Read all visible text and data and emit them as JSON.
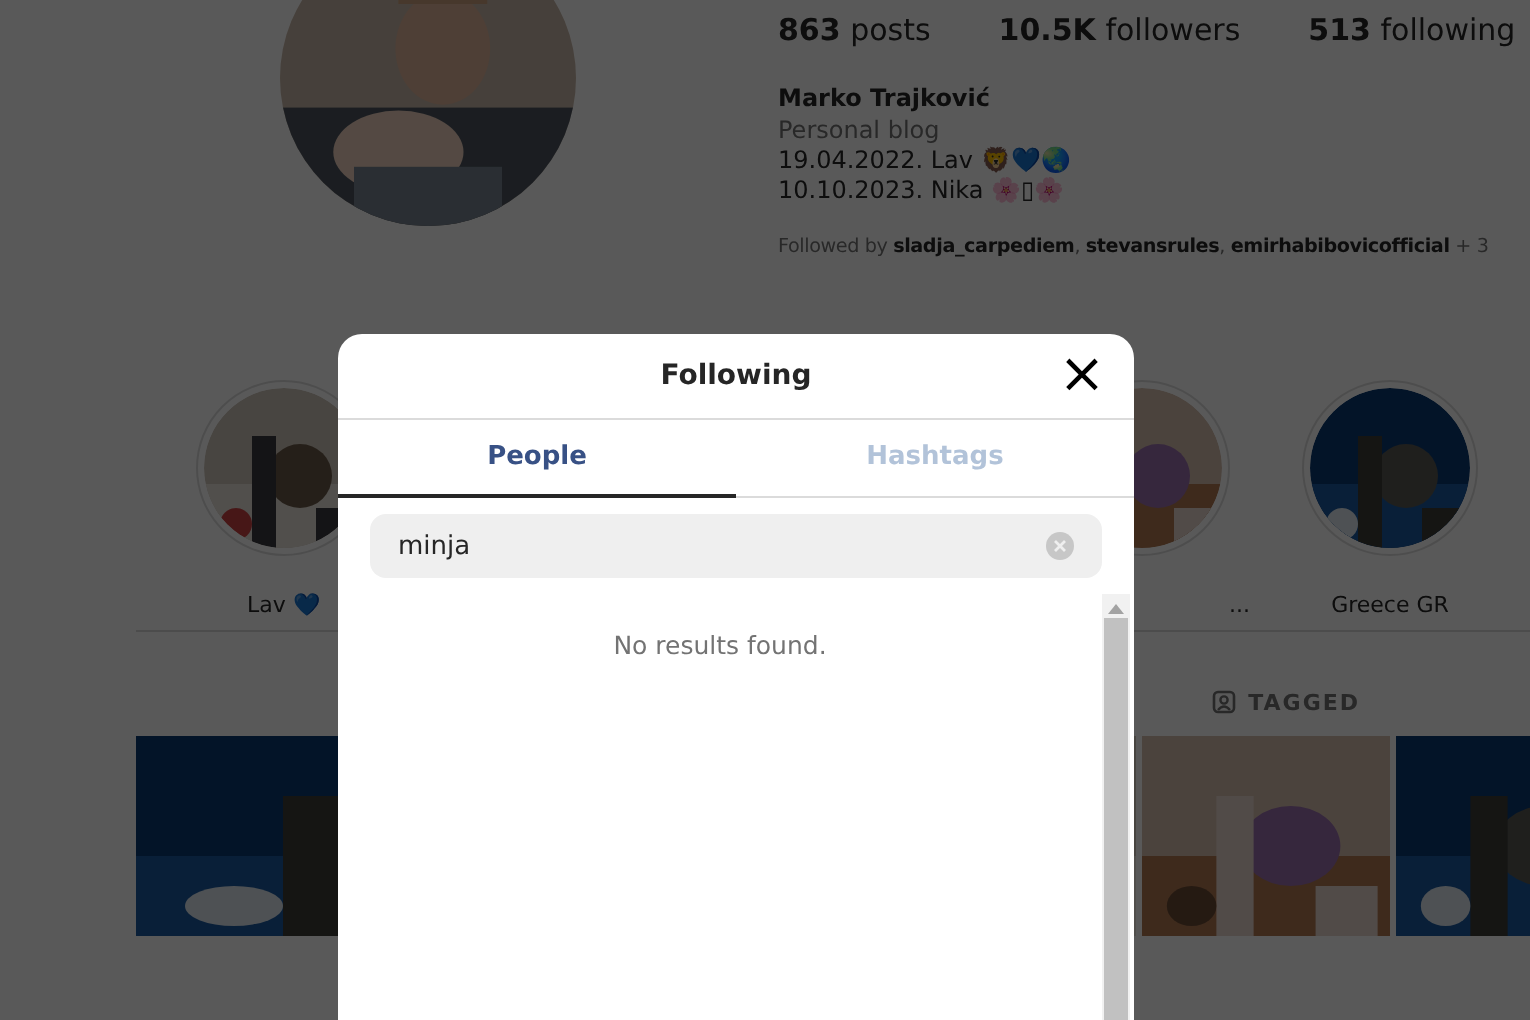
{
  "profile": {
    "stats": [
      "**863** posts",
      "**10.5K** followers",
      "**513** following"
    ],
    "name": "Marko Trajković",
    "category": "Personal blog",
    "bio": [
      "19.04.2022. Lav 🦁💙🌏",
      "10.10.2023. Nika 🌸▯🌸"
    ],
    "followed_by": "Followed by **sladja_carpediem**, **stevansrules**, **emirhabibovicofficial** + 3"
  },
  "highlights": [
    {
      "label": "Lav 💙"
    },
    {
      "label": "..."
    },
    {
      "label": "Greece GR"
    }
  ],
  "profile_tabs": [
    {
      "label": "TAGGED"
    }
  ],
  "dialog": {
    "title": "Following",
    "close": "×",
    "tabs": [
      {
        "label": "People",
        "selected": true
      },
      {
        "label": "Hashtags",
        "selected": false
      }
    ],
    "search": {
      "value": "minja"
    },
    "message": "No results found."
  }
}
